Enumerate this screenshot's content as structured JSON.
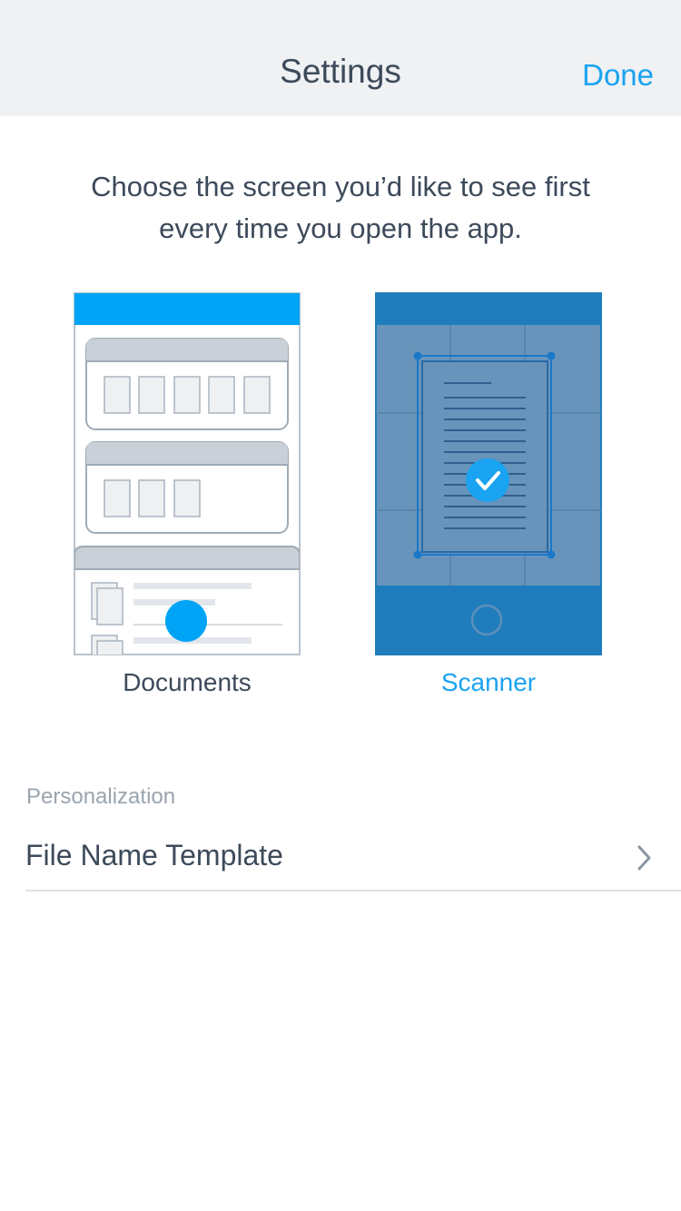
{
  "header": {
    "title": "Settings",
    "done_label": "Done"
  },
  "intro": {
    "line1": "Choose the screen you’d like to see first",
    "line2": "every time you open the app."
  },
  "start_screen": {
    "options": [
      {
        "label": "Documents",
        "selected": false
      },
      {
        "label": "Scanner",
        "selected": true
      }
    ]
  },
  "personalization": {
    "section_title": "Personalization",
    "rows": [
      {
        "label": "File Name Template",
        "icon": "chevron-right-icon"
      }
    ]
  },
  "colors": {
    "accent": "#1aa3f0",
    "text": "#3d4a5a",
    "muted": "#9aa4ae",
    "navbar_bg": "#eff1f3",
    "scanner_bg": "#6894bb",
    "scanner_bar": "#1f7dbd"
  }
}
